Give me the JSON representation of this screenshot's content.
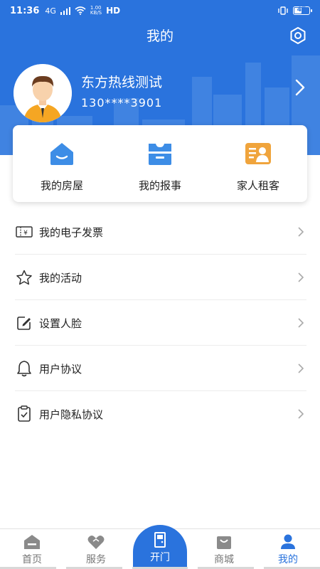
{
  "status_bar": {
    "time": "11:36",
    "network": "4G",
    "speed_top": "1.00",
    "speed_bottom": "KB/S",
    "hd": "HD",
    "battery": "47"
  },
  "header": {
    "title": "我的",
    "settings_icon": "settings-icon"
  },
  "profile": {
    "name": "东方热线测试",
    "phone": "130****3901"
  },
  "quick_actions": [
    {
      "label": "我的房屋",
      "icon": "house-icon",
      "color": "#3d8de6"
    },
    {
      "label": "我的报事",
      "icon": "report-icon",
      "color": "#3d8de6"
    },
    {
      "label": "家人租客",
      "icon": "family-tenant-icon",
      "color": "#f0a43c"
    }
  ],
  "menu": [
    {
      "label": "我的电子发票",
      "icon": "invoice-icon"
    },
    {
      "label": "我的活动",
      "icon": "star-icon"
    },
    {
      "label": "设置人脸",
      "icon": "edit-icon"
    },
    {
      "label": "用户协议",
      "icon": "bell-icon"
    },
    {
      "label": "用户隐私协议",
      "icon": "clipboard-icon"
    }
  ],
  "bottom_nav": {
    "home": "首页",
    "service": "服务",
    "open_door": "开门",
    "mall": "商城",
    "mine": "我的"
  },
  "colors": {
    "primary": "#2a73dd",
    "accent_orange": "#f0a43c",
    "text_dark": "#222222",
    "text_gray": "#777777"
  }
}
